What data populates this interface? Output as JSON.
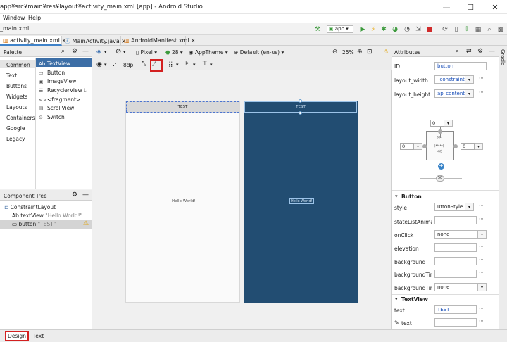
{
  "titlebar": {
    "title": "app¥src¥main¥res¥layout¥activity_main.xml [app] - Android Studio",
    "minimize": "—",
    "maximize": "☐",
    "close": "✕"
  },
  "menu": {
    "window": "Window",
    "help": "Help"
  },
  "navbar": {
    "breadcrumb": "_main.xml",
    "run_config": "app"
  },
  "tabs": [
    {
      "label": "activity_main.xml"
    },
    {
      "label": "MainActivity.java"
    },
    {
      "label": "AndroidManifest.xml"
    }
  ],
  "palette": {
    "title": "Palette",
    "categories": [
      "Common",
      "Text",
      "Buttons",
      "Widgets",
      "Layouts",
      "Containers",
      "Google",
      "Legacy"
    ],
    "items": [
      {
        "icon": "Ab",
        "label": "TextView"
      },
      {
        "icon": "▭",
        "label": "Button"
      },
      {
        "icon": "▣",
        "label": "ImageView"
      },
      {
        "icon": "☰",
        "label": "RecyclerView"
      },
      {
        "icon": "<>",
        "label": "<fragment>"
      },
      {
        "icon": "▤",
        "label": "ScrollView"
      },
      {
        "icon": "⊙",
        "label": "Switch"
      }
    ]
  },
  "component_tree": {
    "title": "Component Tree",
    "nodes": [
      {
        "label": "ConstraintLayout",
        "detail": ""
      },
      {
        "icon": "Ab",
        "label": "textView",
        "detail": "\"Hello World!\""
      },
      {
        "icon": "▭",
        "label": "button",
        "detail": "\"TEST\""
      }
    ]
  },
  "design_toolbar": {
    "device": "Pixel",
    "api": "28",
    "theme": "AppTheme",
    "locale": "Default (en-us)",
    "zoom": "25%",
    "margin": "8dp"
  },
  "preview": {
    "button_text": "TEST",
    "hello": "Hello World!"
  },
  "attributes": {
    "title": "Attributes",
    "id_label": "ID",
    "id_value": "button",
    "layout_width_label": "layout_width",
    "layout_width_value": "_constraint",
    "layout_height_label": "layout_height",
    "layout_height_value": "ap_content",
    "constraint_top": "0",
    "constraint_left": "0",
    "constraint_right": "0",
    "bias": "50",
    "button_section": "Button",
    "style_label": "style",
    "style_value": "uttonStyle",
    "statelist_label": "stateListAnimato",
    "onclick_label": "onClick",
    "onclick_value": "none",
    "elevation_label": "elevation",
    "background_label": "background",
    "backgroundtint_label": "backgroundTint",
    "backgroundtintmode_label": "backgroundTintM",
    "backgroundtintmode_value": "none",
    "textview_section": "TextView",
    "text_label": "text",
    "text_value": "TEST",
    "text2_label": "text"
  },
  "gradle": {
    "label": "Gradle"
  },
  "bottom_tabs": {
    "design": "Design",
    "text": "Text"
  },
  "colors": {
    "blueprint": "#224d72",
    "accent": "#4083c9",
    "highlight": "#d32020"
  }
}
